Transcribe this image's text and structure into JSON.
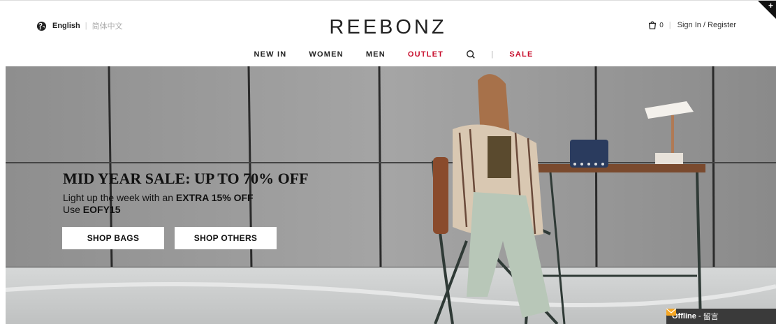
{
  "header": {
    "language_current": "English",
    "language_alt": "简体中文",
    "brand": "REEBONZ",
    "bag_count": "0",
    "signin_label": "Sign In / Register"
  },
  "nav": {
    "items": [
      "NEW IN",
      "WOMEN",
      "MEN",
      "OUTLET"
    ],
    "sale": "SALE"
  },
  "hero": {
    "headline": "MID YEAR SALE: UP TO 70% OFF",
    "sub_prefix": "Light up the week with an ",
    "sub_bold": "EXTRA 15% OFF",
    "code_prefix": "Use ",
    "code": "EOFY15",
    "cta_primary": "SHOP BAGS",
    "cta_secondary": "SHOP OTHERS"
  },
  "chat": {
    "status": "Offline",
    "separator": " - ",
    "label": "留言"
  },
  "colors": {
    "accent_red": "#c8102e",
    "text": "#222222",
    "chat_bg": "#3a3a3a"
  },
  "icons": [
    "globe-icon",
    "shopping-bag-icon",
    "search-icon",
    "mail-icon"
  ]
}
